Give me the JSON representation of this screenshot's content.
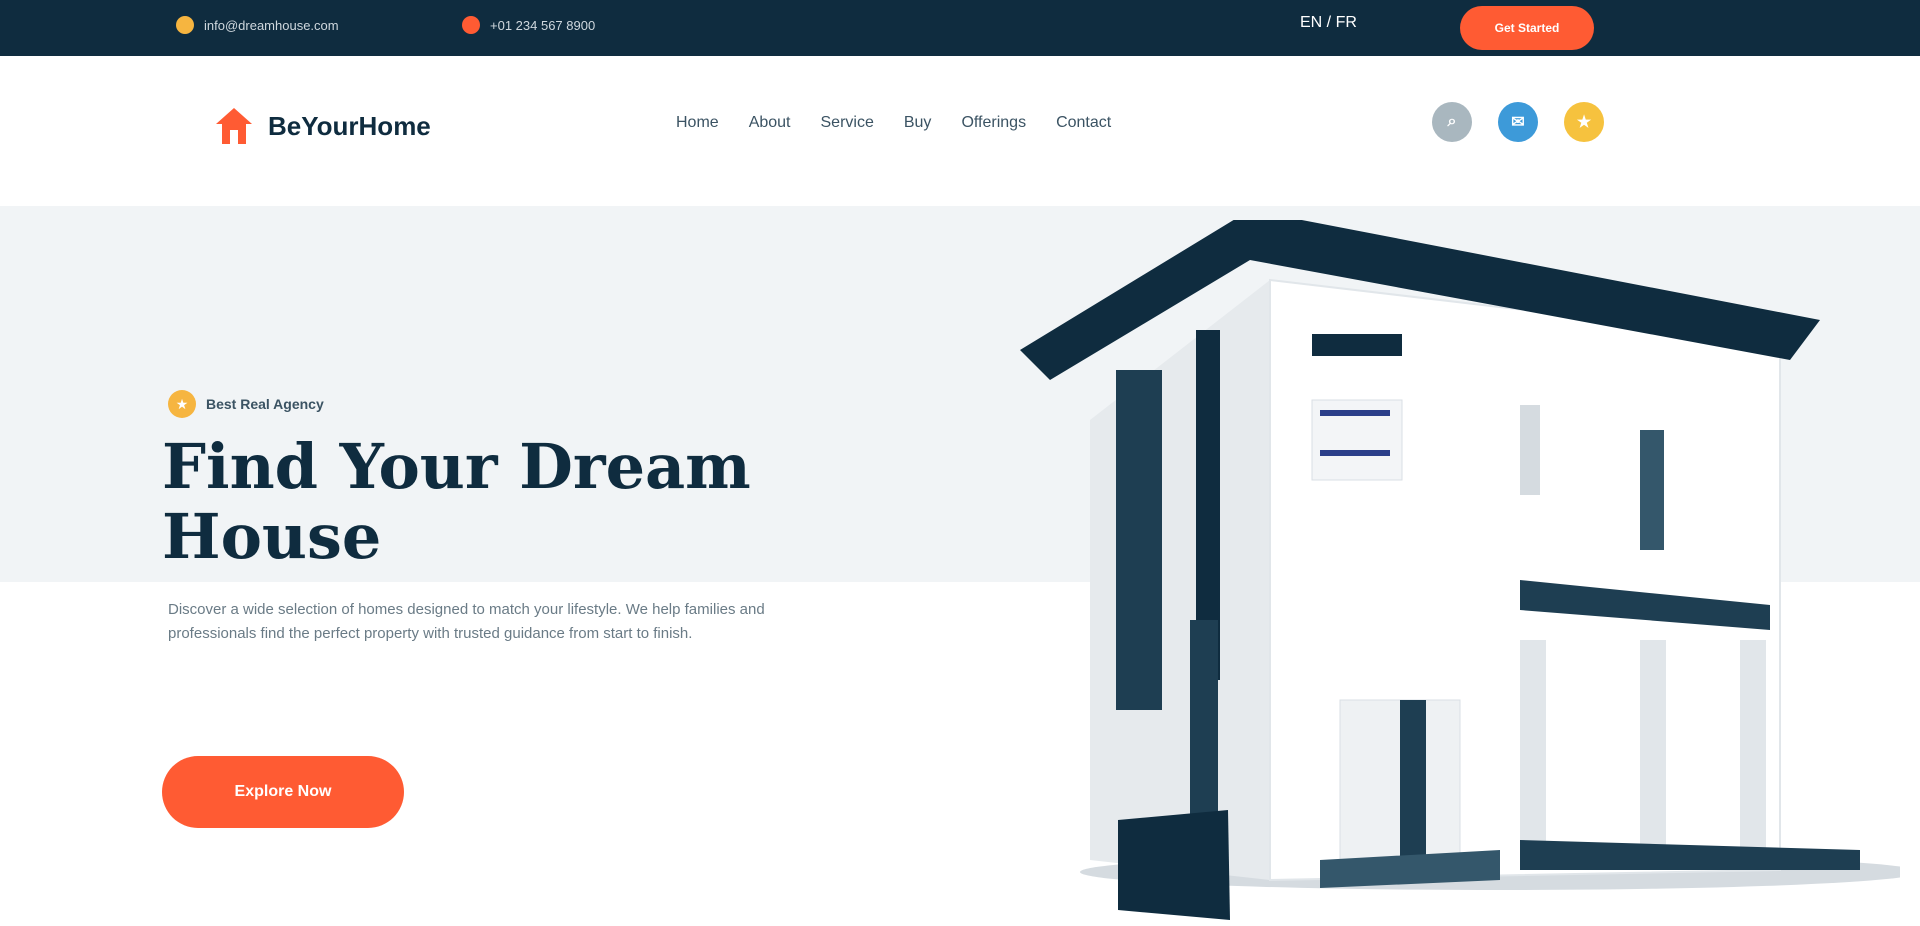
{
  "topbar": {
    "email": "info@dreamhouse.com",
    "phone": "+01 234 567 8900",
    "language": "EN / FR",
    "cta_label": "Get Started",
    "email_icon_color": "#f6b540",
    "phone_icon_color": "#ff5b33"
  },
  "header": {
    "logo_text": "BeYourHome",
    "nav": [
      "Home",
      "About",
      "Service",
      "Buy",
      "Offerings",
      "Contact"
    ],
    "socials": [
      {
        "icon": "search-icon",
        "color": "#a9b7bf",
        "glyph": "⌕"
      },
      {
        "icon": "chat-icon",
        "color": "#3d9ad9",
        "glyph": "✉"
      },
      {
        "icon": "star-icon",
        "color": "#f6c23e",
        "glyph": "★"
      }
    ]
  },
  "hero": {
    "badge": "Best Real Agency",
    "title": "Find Your Dream House",
    "description": "Discover a wide selection of homes designed to match your lifestyle. We help families and professionals find the perfect property with trusted guidance from start to finish.",
    "button_label": "Explore Now"
  },
  "colors": {
    "navy": "#0f2c3f",
    "accent": "#ff5b33",
    "hero_bg": "#f1f4f6"
  }
}
